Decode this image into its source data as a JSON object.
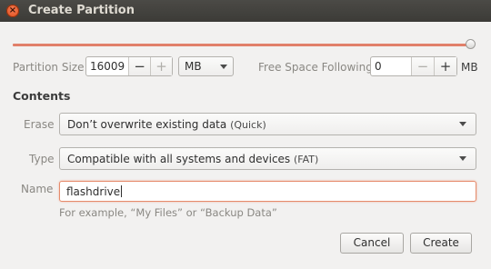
{
  "window": {
    "title": "Create Partition"
  },
  "size_row": {
    "slider_fraction": 1.0,
    "partition_size_label": "Partition Size",
    "partition_size_value": "16009",
    "minus": "−",
    "plus": "+",
    "unit_selected": "MB",
    "free_space_label": "Free Space Following",
    "free_space_value": "0",
    "free_unit": "MB"
  },
  "contents": {
    "heading": "Contents",
    "erase_label": "Erase",
    "erase_value": "Don’t overwrite existing data",
    "erase_hint": "(Quick)",
    "type_label": "Type",
    "type_value": "Compatible with all systems and devices",
    "type_hint": "(FAT)",
    "name_label": "Name",
    "name_value": "flashdrive",
    "name_example": "For example, “My Files” or “Backup Data”"
  },
  "buttons": {
    "cancel": "Cancel",
    "create": "Create"
  }
}
